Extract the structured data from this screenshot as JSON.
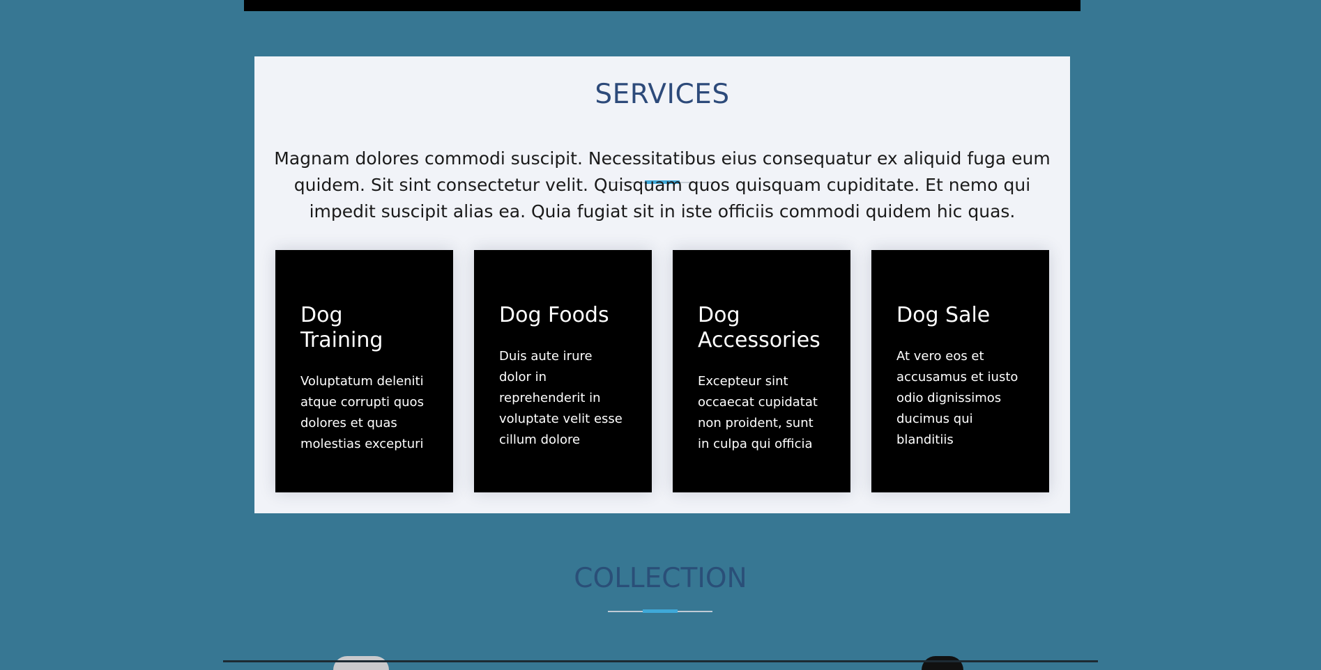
{
  "services": {
    "title": "SERVICES",
    "intro": "Magnam dolores commodi suscipit. Necessitatibus eius consequatur ex aliquid fuga eum quidem. Sit sint consectetur velit. Quisquam quos quisquam cupiditate. Et nemo qui impedit suscipit alias ea. Quia fugiat sit in iste officiis commodi quidem hic quas.",
    "cards": [
      {
        "title": "Dog Training",
        "text": "Voluptatum deleniti atque corrupti quos dolores et quas molestias excepturi"
      },
      {
        "title": "Dog Foods",
        "text": "Duis aute irure dolor in reprehenderit in voluptate velit esse cillum dolore"
      },
      {
        "title": "Dog Accessories",
        "text": "Excepteur sint occaecat cupidatat non proident, sunt in culpa qui officia"
      },
      {
        "title": "Dog Sale",
        "text": "At vero eos et accusamus et iusto odio dignissimos ducimus qui blanditiis"
      }
    ]
  },
  "collection": {
    "title": "COLLECTION"
  },
  "colors": {
    "page_background": "#377793",
    "section_background": "#f1f3f8",
    "card_background": "#000000",
    "title_color": "#2d4a7a",
    "accent": "#3fa9d9"
  }
}
